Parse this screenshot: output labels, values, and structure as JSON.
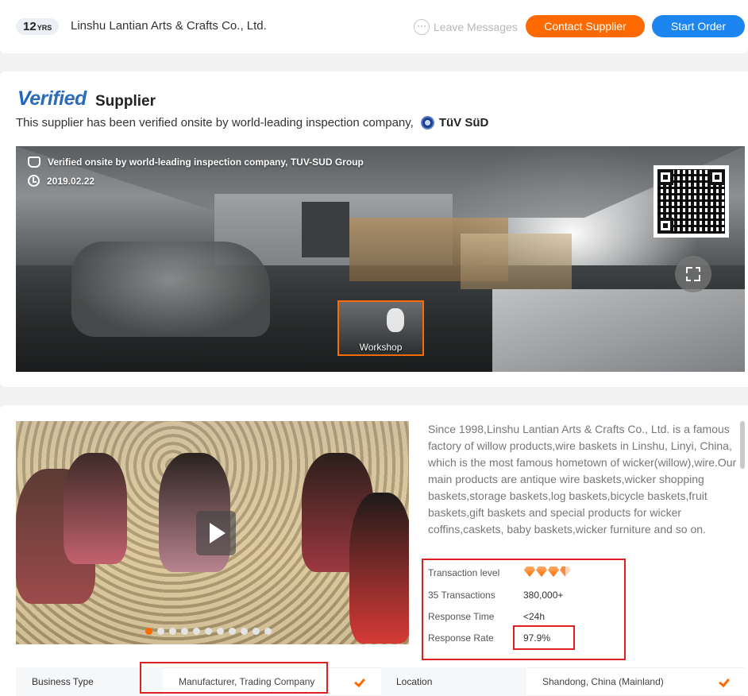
{
  "header": {
    "years_number": "12",
    "years_unit": "YRS",
    "company_name": "Linshu Lantian Arts & Crafts Co., Ltd.",
    "leave_messages": "Leave Messages",
    "contact_supplier": "Contact Supplier",
    "start_order": "Start Order"
  },
  "verified": {
    "logo_text": "erified",
    "logo_letter": "V",
    "supplier_label": "Supplier",
    "description": "This supplier has been verified onsite by world-leading inspection company,",
    "inspector": "TüV SüD",
    "panorama": {
      "caption": "Verified onsite by world-leading inspection company, TUV-SUD Group",
      "date": "2019.02.22",
      "thumb_label": "Workshop"
    }
  },
  "company": {
    "description": "Since 1998,Linshu Lantian Arts & Crafts Co., Ltd. is a famous factory of willow products,wire baskets in Linshu, Linyi, China, which is the most famous hometown of wicker(willow),wire.Our main products are antique wire baskets,wicker shopping baskets,storage baskets,log baskets,bicycle baskets,fruit baskets,gift baskets and special products for wicker coffins,caskets, baby baskets,wicker furniture and so on. What's",
    "carousel_dots": 11,
    "carousel_active": 0,
    "stats": {
      "transaction_level_label": "Transaction level",
      "transaction_level_diamonds": 3.5,
      "transactions_label": "35 Transactions",
      "transactions_value": "380,000+",
      "response_time_label": "Response Time",
      "response_time_value": "<24h",
      "response_rate_label": "Response Rate",
      "response_rate_value": "97.9%"
    },
    "info": {
      "business_type_label": "Business Type",
      "business_type_value": "Manufacturer, Trading Company",
      "location_label": "Location",
      "location_value": "Shandong, China (Mainland)"
    }
  },
  "colors": {
    "accent_orange": "#ff6a00",
    "primary_blue": "#1c85f0",
    "verified_blue": "#2c6cb9",
    "highlight_red": "#e02020"
  }
}
